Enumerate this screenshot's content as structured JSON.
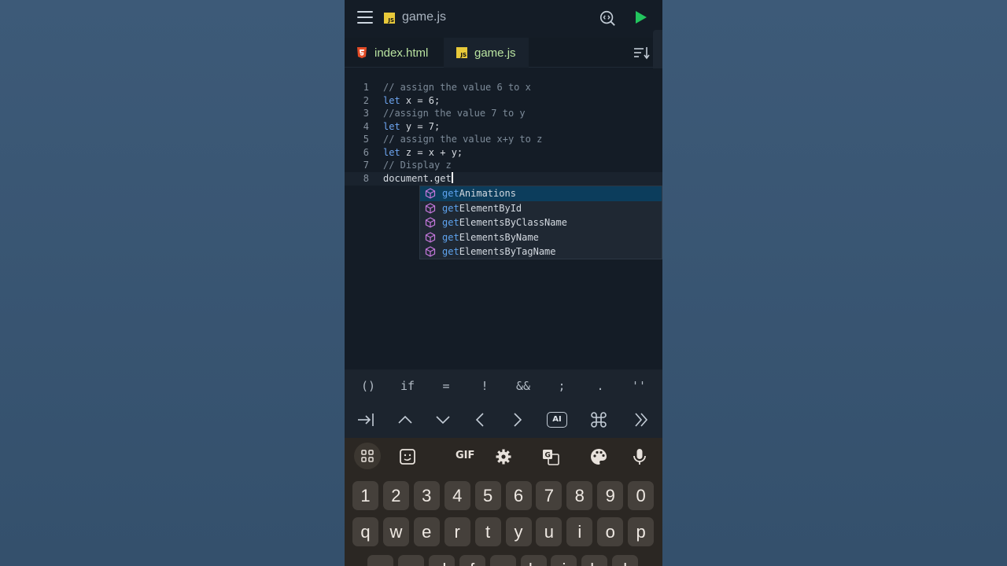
{
  "header": {
    "file_title": "game.js",
    "js_badge": "JS"
  },
  "tabs": [
    {
      "label": "index.html",
      "type": "html"
    },
    {
      "label": "game.js",
      "type": "js",
      "active": true
    }
  ],
  "editor": {
    "lines": [
      {
        "n": "1",
        "kind": "comment",
        "text": "// assign the value 6 to x"
      },
      {
        "n": "2",
        "kind": "code",
        "kw": "let",
        "rest": " x = 6;"
      },
      {
        "n": "3",
        "kind": "comment",
        "text": "//assign the value 7 to y"
      },
      {
        "n": "4",
        "kind": "code",
        "kw": "let",
        "rest": " y = 7;"
      },
      {
        "n": "5",
        "kind": "comment",
        "text": "// assign the value x+y to z"
      },
      {
        "n": "6",
        "kind": "code",
        "kw": "let",
        "rest": " z = x + y;"
      },
      {
        "n": "7",
        "kind": "comment",
        "text": "// Display z"
      },
      {
        "n": "8",
        "kind": "plain",
        "text": "document.get"
      }
    ],
    "suggestions": {
      "match": "get",
      "items": [
        {
          "rest": "Animations",
          "active": true
        },
        {
          "rest": "ElementById"
        },
        {
          "rest": "ElementsByClassName"
        },
        {
          "rest": "ElementsByName"
        },
        {
          "rest": "ElementsByTagName"
        }
      ]
    }
  },
  "symbols": [
    "()",
    "if",
    "=",
    "!",
    "&&",
    ";",
    ".",
    "''"
  ],
  "nav_icons": [
    "tab-icon",
    "arrow-up-icon",
    "arrow-down-icon",
    "arrow-left-icon",
    "arrow-right-icon",
    "ai-icon",
    "command-icon",
    "double-chevron-right-icon"
  ],
  "nav_ai_label": "AI",
  "keyboard": {
    "gif_label": "GIF",
    "number_row": [
      "1",
      "2",
      "3",
      "4",
      "5",
      "6",
      "7",
      "8",
      "9",
      "0"
    ],
    "letter_row": [
      "q",
      "w",
      "e",
      "r",
      "t",
      "y",
      "u",
      "i",
      "o",
      "p"
    ],
    "partial_row": [
      "a",
      "s",
      "d",
      "f",
      "g",
      "h",
      "j",
      "k",
      "l"
    ]
  },
  "colors": {
    "accent_green": "#22c55e",
    "tab_text": "#b9e3a0",
    "keyword": "#6ea6f2",
    "comment": "#7d8b99",
    "suggest_active": "#0c3d5c"
  }
}
